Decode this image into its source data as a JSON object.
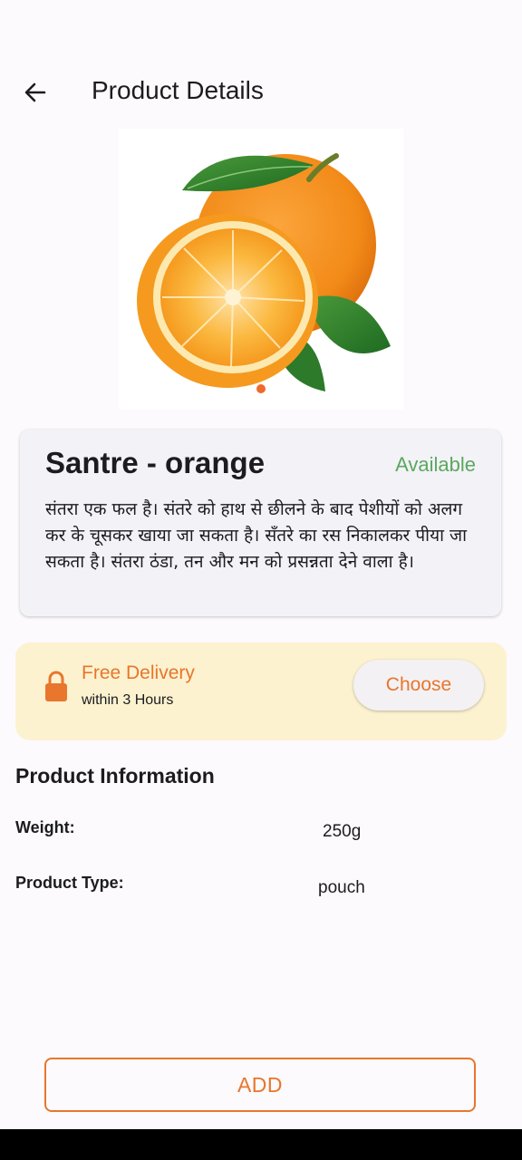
{
  "app_bar": {
    "title": "Product Details",
    "back_icon": "arrow-left-icon"
  },
  "product": {
    "name": "Santre - orange",
    "availability": "Available",
    "description": "संतरा एक फल है। संतरे को हाथ से छीलने के बाद पेशीयों को अलग कर के चूसकर खाया जा सकता है। सँतरे का रस निकालकर पीया जा सकता है। संतरा ठंडा, तन और मन को प्रसन्नता देने वाला है।",
    "image_icon": "orange-fruit-image",
    "carousel": {
      "active_index": 0,
      "count": 1
    }
  },
  "delivery": {
    "title": "Free Delivery",
    "subtitle": "within 3 Hours",
    "choose_label": "Choose",
    "icon": "lock-icon"
  },
  "info": {
    "heading": "Product Information",
    "rows": [
      {
        "label": "Weight:",
        "value": "250g"
      },
      {
        "label": "Product Type:",
        "value": "pouch"
      }
    ]
  },
  "actions": {
    "add_label": "ADD"
  },
  "colors": {
    "accent": "#e8762c",
    "available": "#5aa85e",
    "delivery_bg": "#fcf2cf"
  }
}
